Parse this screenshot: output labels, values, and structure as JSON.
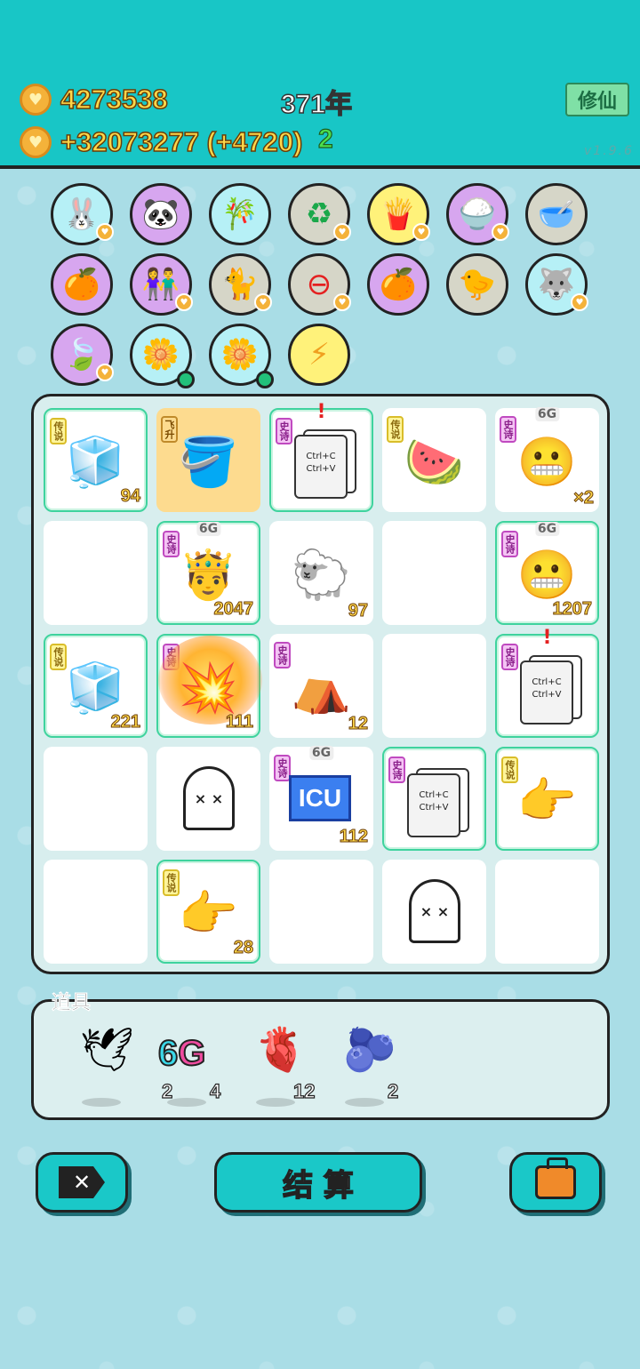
{
  "header": {
    "coins_total": "4273538",
    "coins_rate": "+32073277 (+4720)",
    "green_suffix": "2",
    "year": "371年",
    "mode_button": "修仙",
    "version": "v1.9.6"
  },
  "collection": {
    "row1": [
      "rabbit",
      "panda",
      "bamboo",
      "recycle",
      "fries",
      "rice",
      "dog-bowl"
    ],
    "row2": [
      "pomelo",
      "couple",
      "cat-bed",
      "minus",
      "pomelo",
      "chick",
      "husky"
    ],
    "row3": [
      "leaf",
      "flower-pot",
      "flower-pot",
      "lightning"
    ]
  },
  "board": {
    "tags": {
      "legend": "传说",
      "epic": "史诗",
      "fly": "飞升"
    },
    "six_g": "6G",
    "copy_line1": "Ctrl+C",
    "copy_line2": "Ctrl+V",
    "icu_label": "ICU",
    "ghost_face": "× ×",
    "counts": {
      "r1c1": "94",
      "r1c5": "×2",
      "r2c2": "2047",
      "r2c3": "97",
      "r2c5": "1207",
      "r3c1": "221",
      "r3c2": "111",
      "r3c3": "12",
      "r4c3": "112",
      "r5c2": "28"
    }
  },
  "props": {
    "title": "道具",
    "items": [
      {
        "name": "pigeon",
        "count": "2"
      },
      {
        "name": "6G",
        "count": "4"
      },
      {
        "name": "liver",
        "count": "12"
      },
      {
        "name": "blueberry",
        "count": "2"
      }
    ]
  },
  "buttons": {
    "exit_symbol": "✕",
    "settle": "结 算",
    "bag": "bag"
  }
}
